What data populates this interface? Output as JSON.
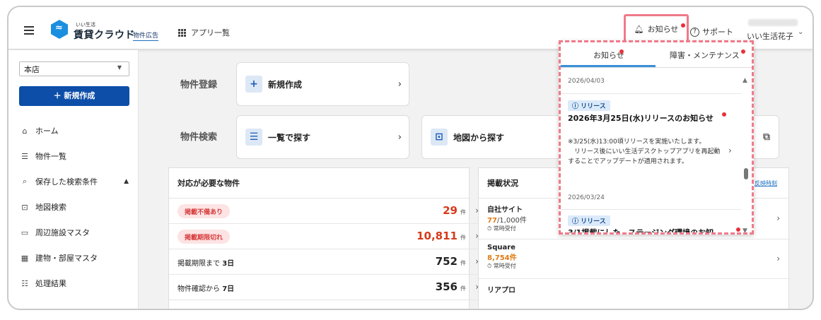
{
  "header": {
    "logo_sub": "いい生活",
    "logo_main": "賃貸クラウド",
    "logo_tag": "物件広告",
    "apps_label": "アプリ一覧",
    "notify_label": "お知らせ",
    "support_label": "サポート",
    "user_name": "いい生活花子"
  },
  "sidebar": {
    "store_value": "本店",
    "new_button": "＋ 新規作成",
    "items": [
      {
        "label": "ホーム",
        "icon": "home-icon"
      },
      {
        "label": "物件一覧",
        "icon": "list-icon"
      },
      {
        "label": "保存した検索条件",
        "icon": "saved-search-icon"
      },
      {
        "label": "地図検索",
        "icon": "map-search-icon"
      },
      {
        "label": "周辺施設マスタ",
        "icon": "facility-icon"
      },
      {
        "label": "建物・部屋マスタ",
        "icon": "building-icon"
      },
      {
        "label": "処理結果",
        "icon": "result-list-icon"
      }
    ]
  },
  "main": {
    "register_label": "物件登録",
    "new_create": "新規作成",
    "search_label": "物件検索",
    "list_search": "一覧で探す",
    "map_search": "地図から探す",
    "action_panel": {
      "title": "対応が必要な物件",
      "rows": [
        {
          "label": "掲載不備あり",
          "count": "29",
          "unit": "件"
        },
        {
          "label": "掲載期限切れ",
          "count": "10,811",
          "unit": "件"
        },
        {
          "label": "掲載期限まで",
          "bold": "3日",
          "count": "752",
          "unit": "件"
        },
        {
          "label": "物件確認から",
          "bold": "7日",
          "count": "356",
          "unit": "件"
        }
      ]
    },
    "status_panel": {
      "title": "掲載状況",
      "link": "反映時刻",
      "sites": [
        {
          "name": "自社サイト",
          "count": "77",
          "total": "/1,000件",
          "time": "常時受付"
        },
        {
          "name": "Square",
          "count": "8,754件",
          "total": "",
          "time": "常時受付"
        },
        {
          "name": "リアプロ",
          "count": "",
          "total": "",
          "time": ""
        }
      ]
    }
  },
  "notifications": {
    "tab_notice": "お知らせ",
    "tab_maintenance": "障害・メンテナンス",
    "date_top": "2026/04/03",
    "item1": {
      "tag": "リリース",
      "title": "2026年3月25日(水)リリースのお知らせ",
      "body": "※3/25(水)13:00頃リリースを実施いたします。\n　リリース後にいい生活デスクトップアプリを再起動することでアップデートが適用されます。",
      "date": "2026/03/24"
    },
    "item2": {
      "tag": "リリース",
      "title": "3/1掲載にした　ステージング環境のお知"
    }
  }
}
